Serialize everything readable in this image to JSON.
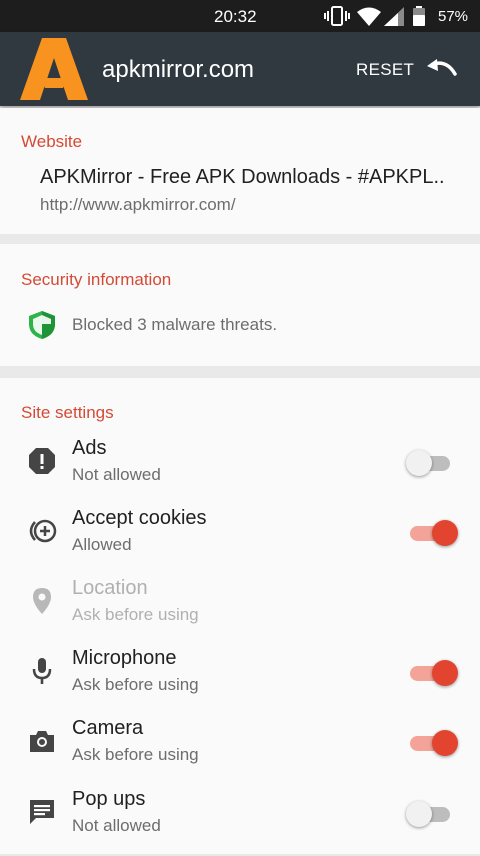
{
  "status_bar": {
    "time": "20:32",
    "battery_pct": "57%"
  },
  "toolbar": {
    "domain": "apkmirror.com",
    "reset_label": "RESET"
  },
  "website": {
    "title": "Website",
    "site_title": "APKMirror - Free APK Downloads - #APKPL..",
    "url": "http://www.apkmirror.com/"
  },
  "security": {
    "title": "Security information",
    "text": "Blocked 3 malware threats."
  },
  "settings": {
    "title": "Site settings",
    "items": [
      {
        "name": "Ads",
        "status": "Not allowed",
        "icon": "alert-icon",
        "toggle": false
      },
      {
        "name": "Accept cookies",
        "status": "Allowed",
        "icon": "cookie-icon",
        "toggle": true
      },
      {
        "name": "Location",
        "status": "Ask before using",
        "icon": "location-pin-icon",
        "disabled": true
      },
      {
        "name": "Microphone",
        "status": "Ask before using",
        "icon": "microphone-icon",
        "toggle": true
      },
      {
        "name": "Camera",
        "status": "Ask before using",
        "icon": "camera-icon",
        "toggle": true
      },
      {
        "name": "Pop ups",
        "status": "Not allowed",
        "icon": "message-icon",
        "toggle": false
      }
    ]
  },
  "colors": {
    "accent": "#d44a35",
    "toolbar": "#303940",
    "toggle_on": "#e2442f"
  }
}
